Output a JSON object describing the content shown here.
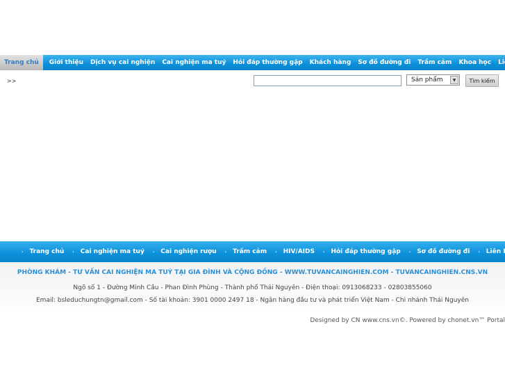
{
  "top_nav": {
    "items": [
      {
        "label": "Trang chủ"
      },
      {
        "label": "Giới thiệu"
      },
      {
        "label": "Dịch vụ cai nghiện"
      },
      {
        "label": "Cai nghiện ma tuý"
      },
      {
        "label": "Hỏi đáp thường gặp"
      },
      {
        "label": "Khách hàng"
      },
      {
        "label": "Sơ đồ đường đi"
      },
      {
        "label": "Trầm cảm"
      },
      {
        "label": "Khoa học"
      },
      {
        "label": "Liên hệ"
      }
    ]
  },
  "breadcrumb": ">>",
  "search": {
    "value": "",
    "category_selected": "Sản phẩm",
    "button_label": "Tìm kiếm",
    "chevron_icon": "chevron-down-icon"
  },
  "footer_nav": {
    "items": [
      {
        "label": "Trang chủ"
      },
      {
        "label": "Cai nghiện ma tuý"
      },
      {
        "label": "Cai nghiện rượu"
      },
      {
        "label": "Trầm cảm"
      },
      {
        "label": "HIV/AIDS"
      },
      {
        "label": "Hỏi đáp thường gặp"
      },
      {
        "label": "Sơ đồ đường đi"
      },
      {
        "label": "Liên He"
      }
    ],
    "separator": "›"
  },
  "footer": {
    "title": "PHÒNG KHÁM - TƯ VẤN CAI NGHIỆN MA TUÝ TẠI GIA ĐÌNH VÀ CỘNG ĐỒNG - WWW.TUVANCAINGHIEN.COM - TUVANCAINGHIEN.CNS.VN",
    "address": "Ngõ số 1 - Đường Minh Cầu - Phan Đình Phùng - Thành phố Thái Nguyên - Điện thoại: 0913068233 - 02803855060",
    "email": "Email: bsleduchungtn@gmail.com - Số tài khoản: 3901 0000 2497 18 - Ngân hàng đầu tư và phát triển Việt Nam - Chi nhánh Thái Nguyên"
  },
  "credits": "Designed by CN www.cns.vn©. Powered by chonet.vn™ Portal",
  "colors": {
    "nav_blue": "#0a8fd9",
    "footer_title": "#2b8fd6"
  }
}
